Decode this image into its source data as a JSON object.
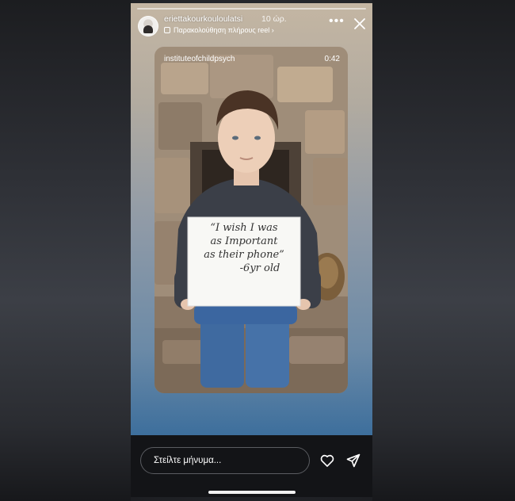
{
  "story": {
    "username": "eriettakourkouloulatsi",
    "time": "10 ώρ.",
    "reel_link": "Παρακολούθηση πλήρους reel ›",
    "more_icon": "more-icon",
    "close_icon": "close-icon"
  },
  "reel": {
    "username": "instituteofchildpsych",
    "duration": "0:42",
    "sign_lines": [
      "“I wish I was",
      "as Important",
      "as their phone”",
      "-6yr old"
    ]
  },
  "footer": {
    "message_placeholder": "Στείλτε μήνυμα...",
    "heart_icon": "heart-icon",
    "send_icon": "send-icon"
  },
  "colors": {
    "accent_blue": "#2f628f",
    "bar_bg": "#131417"
  }
}
